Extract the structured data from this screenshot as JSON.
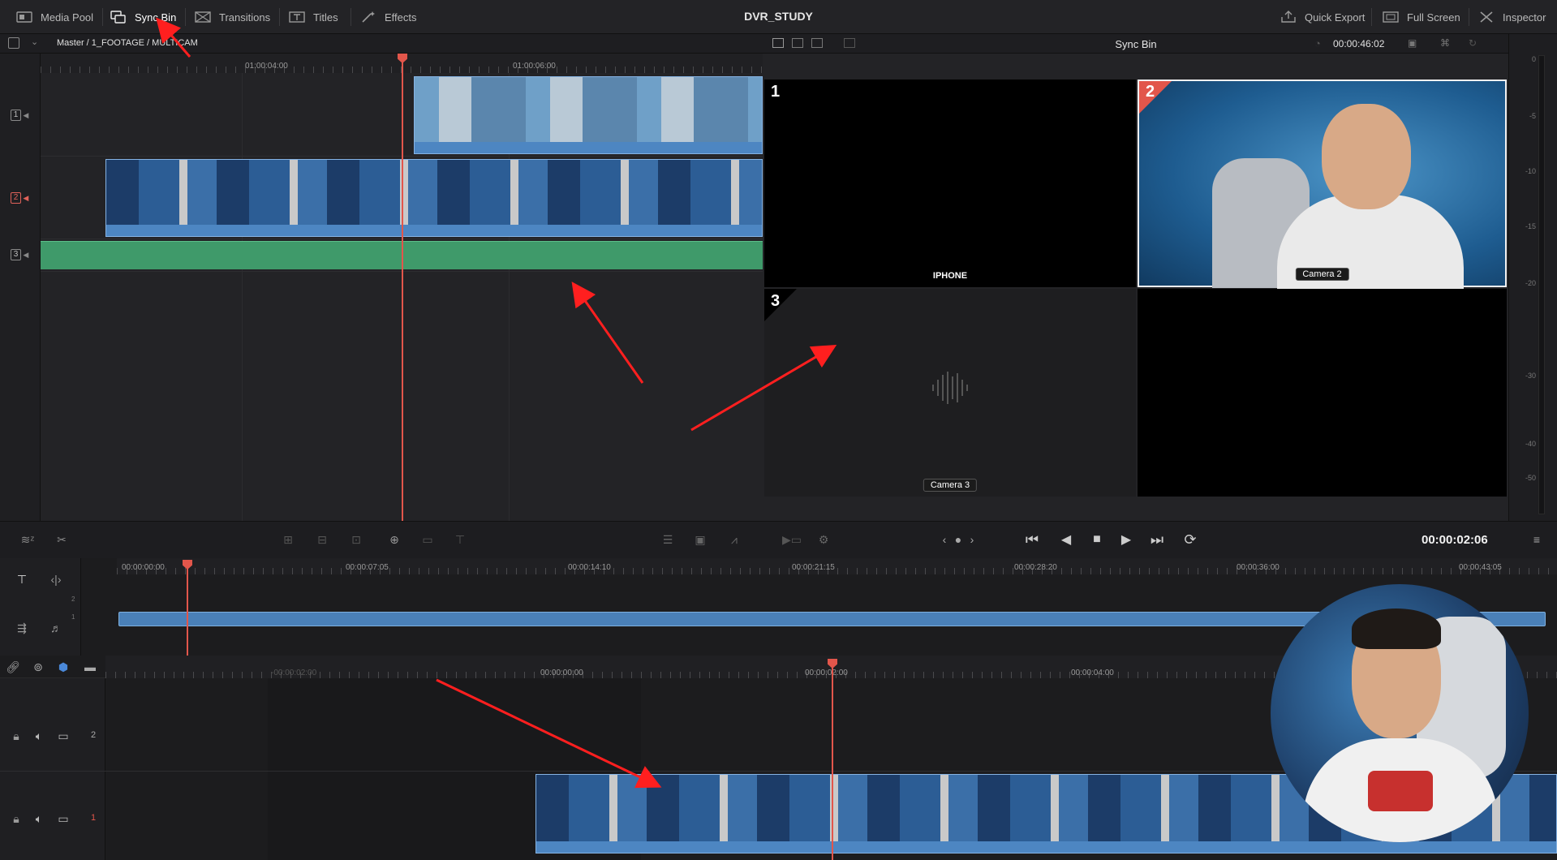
{
  "topbar": {
    "media_pool": "Media Pool",
    "sync_bin": "Sync Bin",
    "transitions": "Transitions",
    "titles": "Titles",
    "effects": "Effects",
    "project_title": "DVR_STUDY",
    "quick_export": "Quick Export",
    "full_screen": "Full Screen",
    "inspector": "Inspector"
  },
  "source_viewer": {
    "breadcrumb": "Master / 1_FOOTAGE / MULTICAM",
    "ruler_labels": [
      "01:00:04:00",
      "01:00:06:00"
    ],
    "track_labels": [
      "1",
      "2",
      "3"
    ]
  },
  "multicam_viewer": {
    "title": "Sync Bin",
    "timecode": "00:00:46:02",
    "angles": [
      {
        "number": "1",
        "label": "IPHONE"
      },
      {
        "number": "2",
        "label": "Camera 2"
      },
      {
        "number": "3",
        "label": "Camera 3"
      }
    ]
  },
  "meters": {
    "scale": [
      "0",
      "-5",
      "-10",
      "-15",
      "-20",
      "-30",
      "-40",
      "-50"
    ]
  },
  "transport": {
    "timecode": "00:00:02:06"
  },
  "upper_timeline": {
    "ruler_labels": [
      "00:00:00:00",
      "00:00:07:05",
      "00:00:14:10",
      "00:00:21:15",
      "00:00:28:20",
      "00:00:36:00",
      "00:00:43:05"
    ],
    "track_numbers": [
      "2",
      "1"
    ]
  },
  "lower_timeline": {
    "ruler_labels": [
      "-00:00:02:00",
      "00:00:00:00",
      "00:00:02:00",
      "00:00:04:00"
    ],
    "track_numbers": [
      "2",
      "1"
    ]
  },
  "colors": {
    "accent": "#e2564b",
    "clip_blue": "#4a7fb6",
    "audio_green": "#3f9a6a",
    "annotation_red": "#ff1f1f"
  }
}
